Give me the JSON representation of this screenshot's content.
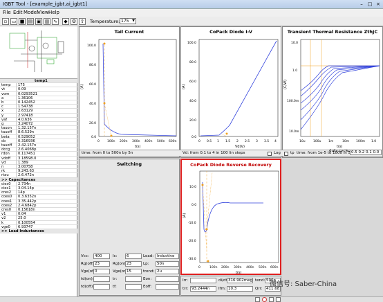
{
  "window": {
    "title": "IGBT Tool - [example_igbt.ai_igbt1]"
  },
  "menu": [
    "File",
    "Edit",
    "Model",
    "View",
    "Help"
  ],
  "toolbar": {
    "temperature_label": "Temperature:",
    "temperature_value": "175"
  },
  "params_header": "temp1",
  "params": [
    [
      "temp",
      "175"
    ],
    [
      "vt",
      "0.09"
    ],
    [
      "vom",
      "0.0293521"
    ],
    [
      "a",
      "1.36106"
    ],
    [
      "b",
      "0.142452"
    ],
    [
      "c",
      "1.54738"
    ],
    [
      "x",
      "2.63129"
    ],
    [
      "y",
      "2.97418"
    ],
    [
      "vaf",
      "4.0.636"
    ],
    [
      "g",
      "3.24072"
    ],
    [
      "tauon",
      "1.32.157n"
    ],
    [
      "tauoff",
      "8.6.529n"
    ],
    [
      "beta",
      "0.529052"
    ],
    [
      "cb",
      "0.316936"
    ],
    [
      "tauoff",
      "2.42.157n"
    ],
    [
      "dccg",
      "2.6.4068p"
    ],
    [
      "rdon",
      "0.117451"
    ],
    [
      "vdoff",
      "3.18598.0"
    ],
    [
      "vd",
      "1.389"
    ],
    [
      "n",
      "3.00758"
    ],
    [
      "rk",
      "9.243.63"
    ],
    [
      "rtau",
      "2.6.472n"
    ]
  ],
  "cap_header": ">> Capacitances",
  "caps": [
    [
      "cies0",
      "2.734n"
    ],
    [
      "cies1",
      "3.04.14p"
    ],
    [
      "cres2",
      "14p"
    ],
    [
      "coes0",
      "0.3.6352n"
    ],
    [
      "coes1",
      "3.35.442p"
    ],
    [
      "coes2",
      "2.4.6842p"
    ],
    [
      "cres0",
      "0.15618n"
    ],
    [
      "v1",
      "0.04"
    ],
    [
      "v2",
      "25.0"
    ],
    [
      "k",
      "0.100554"
    ],
    [
      "vge0",
      "6.93747"
    ]
  ],
  "ind_header": ">> Lead Inductances",
  "plots": {
    "tail": {
      "title": "Tail Current",
      "ylabel": "(A)",
      "xlabel": "t(s)",
      "xticks": [
        "0",
        "100n",
        "200n",
        "300n",
        "400n",
        "500n",
        "600n"
      ],
      "yticks": [
        "100.0",
        "80.0",
        "60.0",
        "40.0",
        "20.0",
        "0.0"
      ],
      "sweep": "time:  from 0 to 500n by 5n"
    },
    "diode": {
      "title": "CoPack Diode I-V",
      "ylabel": "(A)",
      "xlabel": "Vd(V)",
      "xticks": [
        "0",
        "0.5",
        "1",
        "1.5",
        "2",
        "2.5",
        "3",
        "3.5",
        "4"
      ],
      "yticks": [
        "100.0",
        "80.0",
        "60.0",
        "40.0",
        "20.0",
        "0.0"
      ],
      "sweep": "Vd:  from 0.1 to 4 in 100 lin steps",
      "log_label": "Log",
      "tp_label": "tp"
    },
    "thermal": {
      "title": "Transient Thermal Resistance ZthJC",
      "ylabel": "(C/W)",
      "xlabel": "t(s)",
      "xticks": [
        "10u",
        "100u",
        "1m",
        "10m",
        "100m",
        "1.0"
      ],
      "yticks": [
        "10.0",
        "1.0",
        "100.0m",
        "10.0m"
      ],
      "sweep": "time: from 1e-5 to 1000 in 50 log steps",
      "duty_label": "duty cycle:",
      "duty_value": "0.5 0.2 0.1 0.0"
    },
    "switching": {
      "title": "Switching"
    },
    "reverse": {
      "title": "CoPack Diode Reverse Recovery",
      "ylabel": "(A)",
      "xlabel": "t(s)",
      "xticks": [
        "0",
        "100n",
        "200n",
        "300n",
        "400n",
        "500n",
        "600n"
      ],
      "yticks": [
        "10.0",
        "0.0",
        "-10.0",
        "-20.0",
        "-30.0"
      ]
    }
  },
  "switching_fields": [
    [
      "Vcc:",
      "400",
      "Ic:",
      "6",
      "Load:",
      "Inductive"
    ],
    [
      "Rg(off):",
      "23",
      "Rg(on):",
      "23",
      "Lp:",
      "50n"
    ],
    [
      "Vge(off):",
      "0",
      "Vge(on):",
      "15",
      "trend:",
      "2u"
    ],
    [
      "td(on):",
      "",
      "tr:",
      "",
      "Eon:",
      ""
    ],
    [
      "td(off):",
      "",
      "tf:",
      "",
      "Eoff:",
      ""
    ]
  ],
  "rr_fields": {
    "irr_label": "Irr:",
    "irr": "",
    "didt_label": "di/dt:",
    "didt": "316.902meg",
    "tend_label": "tend:",
    "tend": "500n",
    "trr_label": "trr:",
    "trr": "93.2444n",
    "ifm_label": "Ifm:",
    "ifm": "10.3",
    "qrr_label": "Qrr:",
    "qrr": "411.683n"
  },
  "watermark": "微信号: Saber-China"
}
